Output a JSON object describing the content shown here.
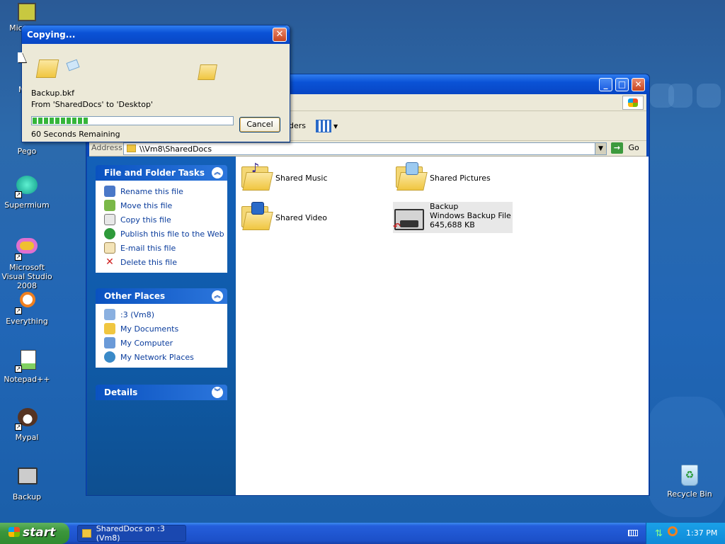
{
  "desktop": {
    "icons": [
      {
        "label": "Mic Ou",
        "name": "microsoft-outlook"
      },
      {
        "label": "My",
        "name": "my-computer"
      },
      {
        "label": "Pego",
        "name": "pego"
      },
      {
        "label": "Supermium",
        "name": "supermium"
      },
      {
        "label": "Microsoft Visual Studio 2008",
        "name": "visual-studio"
      },
      {
        "label": "Everything",
        "name": "everything"
      },
      {
        "label": "Notepad++",
        "name": "notepadpp"
      },
      {
        "label": "Mypal",
        "name": "mypal"
      },
      {
        "label": "Backup",
        "name": "backup"
      },
      {
        "label": "Recycle Bin",
        "name": "recycle-bin"
      }
    ]
  },
  "copy_dialog": {
    "title": "Copying...",
    "filename": "Backup.bkf",
    "from_to": "From 'SharedDocs' to 'Desktop'",
    "progress": 0.28,
    "remaining": "60 Seconds Remaining",
    "cancel_label": "Cancel"
  },
  "explorer": {
    "toolbar_folders_label": "ders",
    "address_label": "Address",
    "address_value": "\\\\Vm8\\SharedDocs",
    "go_label": "Go",
    "file_tasks": {
      "title": "File and Folder Tasks",
      "items": [
        "Rename this file",
        "Move this file",
        "Copy this file",
        "Publish this file to the Web",
        "E-mail this file",
        "Delete this file"
      ]
    },
    "other_places": {
      "title": "Other Places",
      "items": [
        ":3 (Vm8)",
        "My Documents",
        "My Computer",
        "My Network Places"
      ]
    },
    "details": {
      "title": "Details"
    },
    "items": [
      {
        "name": "Shared Music",
        "icon": "music-folder-icon"
      },
      {
        "name": "Shared Pictures",
        "icon": "pictures-folder-icon"
      },
      {
        "name": "Shared Video",
        "icon": "video-folder-icon"
      },
      {
        "name": "Backup",
        "type": "Windows Backup File",
        "size": "645,688 KB",
        "icon": "backup-file-icon"
      }
    ]
  },
  "taskbar": {
    "start_label": "start",
    "active_window": "SharedDocs on :3 (Vm8)",
    "clock": "1:37 PM"
  },
  "colors": {
    "xp_blue": "#0a52d6",
    "start_green": "#3c963c",
    "progress_green": "#35b53a"
  }
}
